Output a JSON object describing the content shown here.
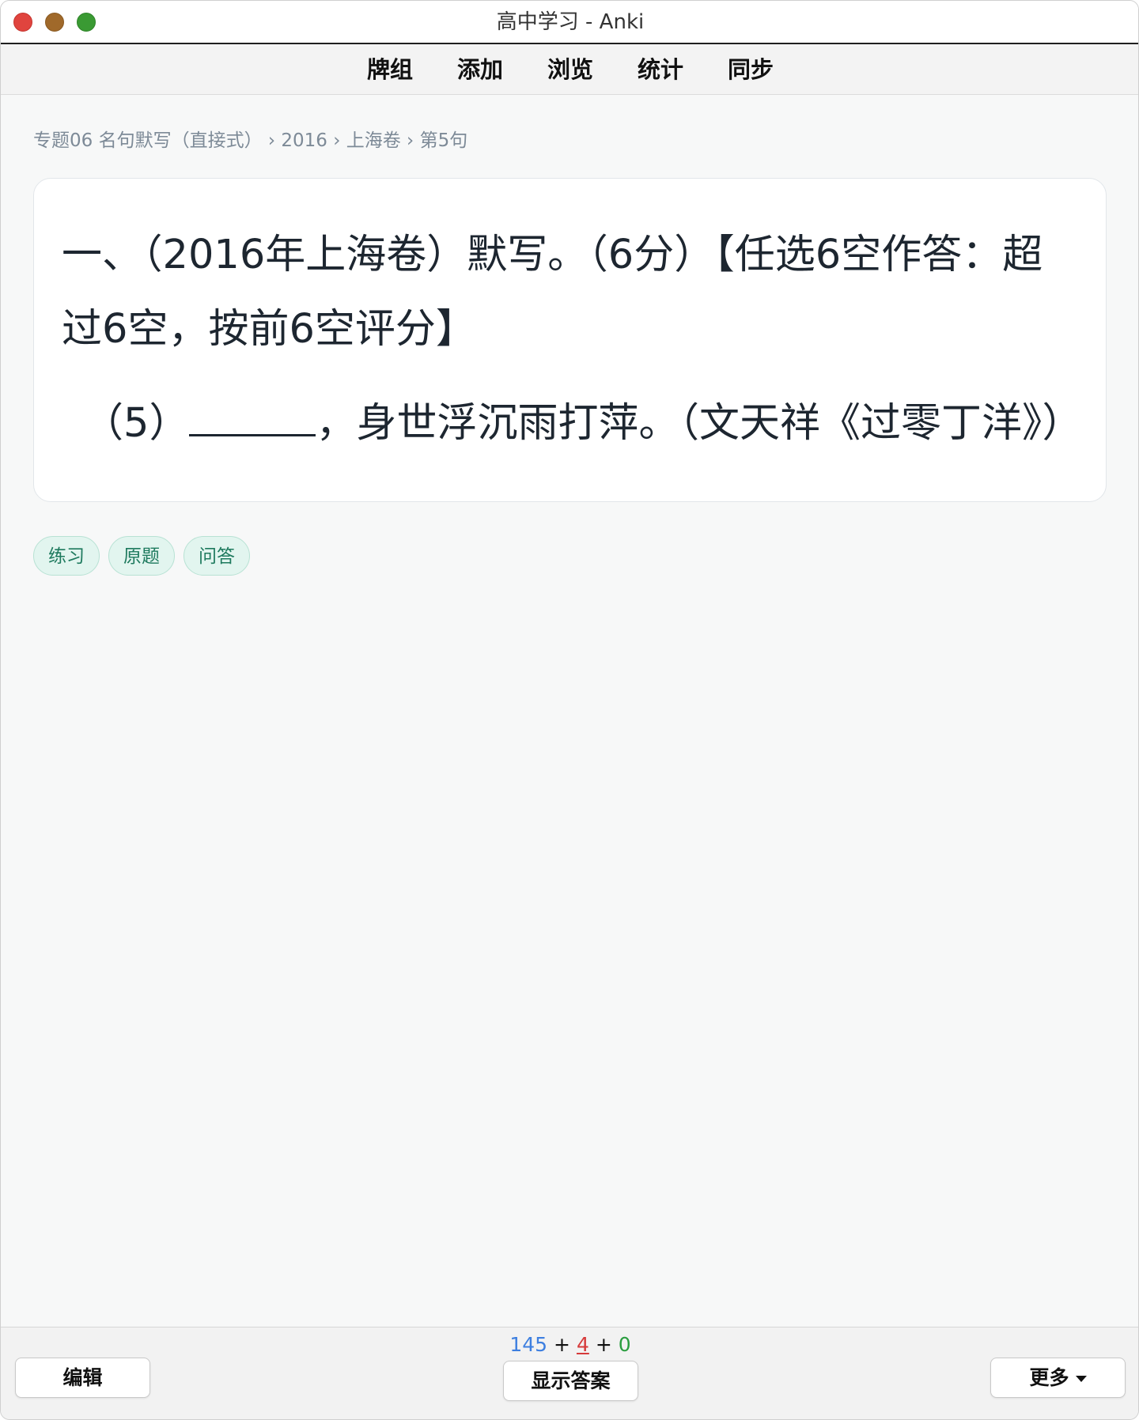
{
  "window": {
    "title": "高中学习 - Anki"
  },
  "toolbar": {
    "items": [
      "牌组",
      "添加",
      "浏览",
      "统计",
      "同步"
    ]
  },
  "breadcrumb": "专题06 名句默写（直接式） › 2016 › 上海卷 › 第5句",
  "card": {
    "question_line1": "一、（2016年上海卷）默写。（6分）【任选6空作答：超",
    "question_line2": "过6空，按前6空评分】",
    "item_prefix": "（5）",
    "item_suffix": "，身世浮沉雨打萍。（文天祥《过零丁洋》）"
  },
  "tags": [
    "练习",
    "原题",
    "问答"
  ],
  "bottombar": {
    "edit_label": "编辑",
    "show_answer_label": "显示答案",
    "more_label": "更多",
    "counts": {
      "new": "145",
      "learning": "4",
      "review": "0",
      "separator": "+"
    }
  },
  "colors": {
    "new_count": "#3d7fe0",
    "learning_count": "#d63a3a",
    "review_count": "#2a9d3f",
    "tag_bg": "#e2f5ef",
    "tag_text": "#1e7a5e"
  }
}
